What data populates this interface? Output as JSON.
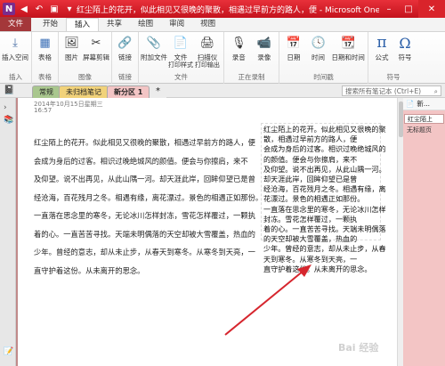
{
  "window": {
    "title": "红尘陌上的花开，似此相见又很晚的聚散，相遇过早前方的路人，便 - Microsoft OneNote(产品激活失败)",
    "logo_glyph": "N",
    "min_glyph": "–",
    "max_glyph": "□",
    "close_glyph": "✕"
  },
  "ribbon_tabs": [
    "文件",
    "开始",
    "插入",
    "共享",
    "绘图",
    "审阅",
    "视图"
  ],
  "ribbon": {
    "groups": [
      {
        "label": "插入",
        "buttons": [
          {
            "label": "插入空间",
            "icon": "insert-space-icon",
            "glyph": "⤓"
          }
        ]
      },
      {
        "label": "表格",
        "buttons": [
          {
            "label": "表格",
            "icon": "table-icon",
            "glyph": "▦"
          }
        ]
      },
      {
        "label": "图像",
        "buttons": [
          {
            "label": "图片",
            "icon": "picture-icon",
            "glyph": "🖼"
          },
          {
            "label": "屏幕剪辑",
            "icon": "screen-clipping-icon",
            "glyph": "✂"
          }
        ]
      },
      {
        "label": "链接",
        "buttons": [
          {
            "label": "链接",
            "icon": "link-icon",
            "glyph": "🔗"
          }
        ]
      },
      {
        "label": "文件",
        "buttons": [
          {
            "label": "附加文件",
            "icon": "attach-file-icon",
            "glyph": "📎"
          },
          {
            "label": "文件",
            "sub": "打印样式",
            "icon": "file-printout-icon",
            "glyph": "📄"
          },
          {
            "label": "扫描仪",
            "sub": "打印输出",
            "icon": "scanner-printout-icon",
            "glyph": "🖨"
          }
        ]
      },
      {
        "label": "正在录制",
        "buttons": [
          {
            "label": "录音",
            "icon": "record-audio-icon",
            "glyph": "🎙"
          },
          {
            "label": "录像",
            "icon": "record-video-icon",
            "glyph": "📹"
          }
        ]
      },
      {
        "label": "时间戳",
        "buttons": [
          {
            "label": "日期",
            "icon": "date-icon",
            "glyph": "📅"
          },
          {
            "label": "时间",
            "icon": "time-icon",
            "glyph": "🕓"
          },
          {
            "label": "日期和时间",
            "icon": "date-time-icon",
            "glyph": "📆"
          }
        ]
      },
      {
        "label": "符号",
        "buttons": [
          {
            "label": "公式",
            "icon": "equation-icon",
            "glyph": "π"
          },
          {
            "label": "符号",
            "icon": "symbol-icon",
            "glyph": "Ω"
          }
        ]
      }
    ]
  },
  "notebook_bar": {
    "sections": [
      {
        "label": "常规",
        "color": "#a9c78e"
      },
      {
        "label": "未归档笔记",
        "color": "#f1d27a"
      },
      {
        "label": "新分区 1",
        "color": "#f3c5c5",
        "active": true
      }
    ],
    "add_glyph": "*",
    "search_placeholder": "搜索所有笔记本 (Ctrl+E)",
    "search_glyph": "⌕"
  },
  "page": {
    "date": "2014年10月15日星期三",
    "time": "16:57",
    "left_lines": [
      "红尘陌上的花开。似此相见又很晚的聚散，相遇过早前方的路人，便",
      "会成为身后的过客。相识过晚绝城风的颜值。便会与你擦肩，来不",
      "及仰望。说不出再见，从此山隅一河。却天涯此岸，回眸仰望已是曾",
      "经沧海，百花残月之冬。相遇有缘，离花漂过。景色的相遇正如那份。",
      "一直落在思念里的寒冬，无论冰川怎样封冻，雪花怎样覆过，一颗执",
      "着的心。一直苦苦寻找。天端未明偶落的天空却被大雪覆盖，热血的",
      "少年。曾经的意志，却从未止步，从春天到寒冬。从寒冬到天亮，一",
      "直守护着这份。从未离开的思念。"
    ],
    "right_lines": [
      "红尘陌上的花开。似此相见又很晚的聚",
      "散，相遇过早前方的路人，便",
      "会成为身后的过客。相识过晚绝城风的",
      "的颜值。便会与你擦肩，来不",
      "及仰望。说不出再见，从此山隅一河。",
      "却天涯此岸，回眸仰望已是曾",
      "经沧海，百花残月之冬。相遇有缘，离",
      "花漂过。景色的相遇正如那份。",
      "一直落在思念里的寒冬，无论冰川怎样",
      "封冻。雪花怎样覆过，一颗执",
      "着的心。一直苦苦寻找。天端未明偶落",
      "的天空却被大雪覆盖，热血的",
      "少年。曾经的意志，却从未止步，从春",
      "天到寒冬。从寒冬到天亮，一",
      "直守护着这份。从未离开的思念。"
    ]
  },
  "page_panel": {
    "new_page": "新...",
    "pages": [
      {
        "label": "红尘陌上",
        "selected": true
      },
      {
        "label": "无标题页",
        "selected": false
      }
    ]
  },
  "watermark": "Bai 经验"
}
